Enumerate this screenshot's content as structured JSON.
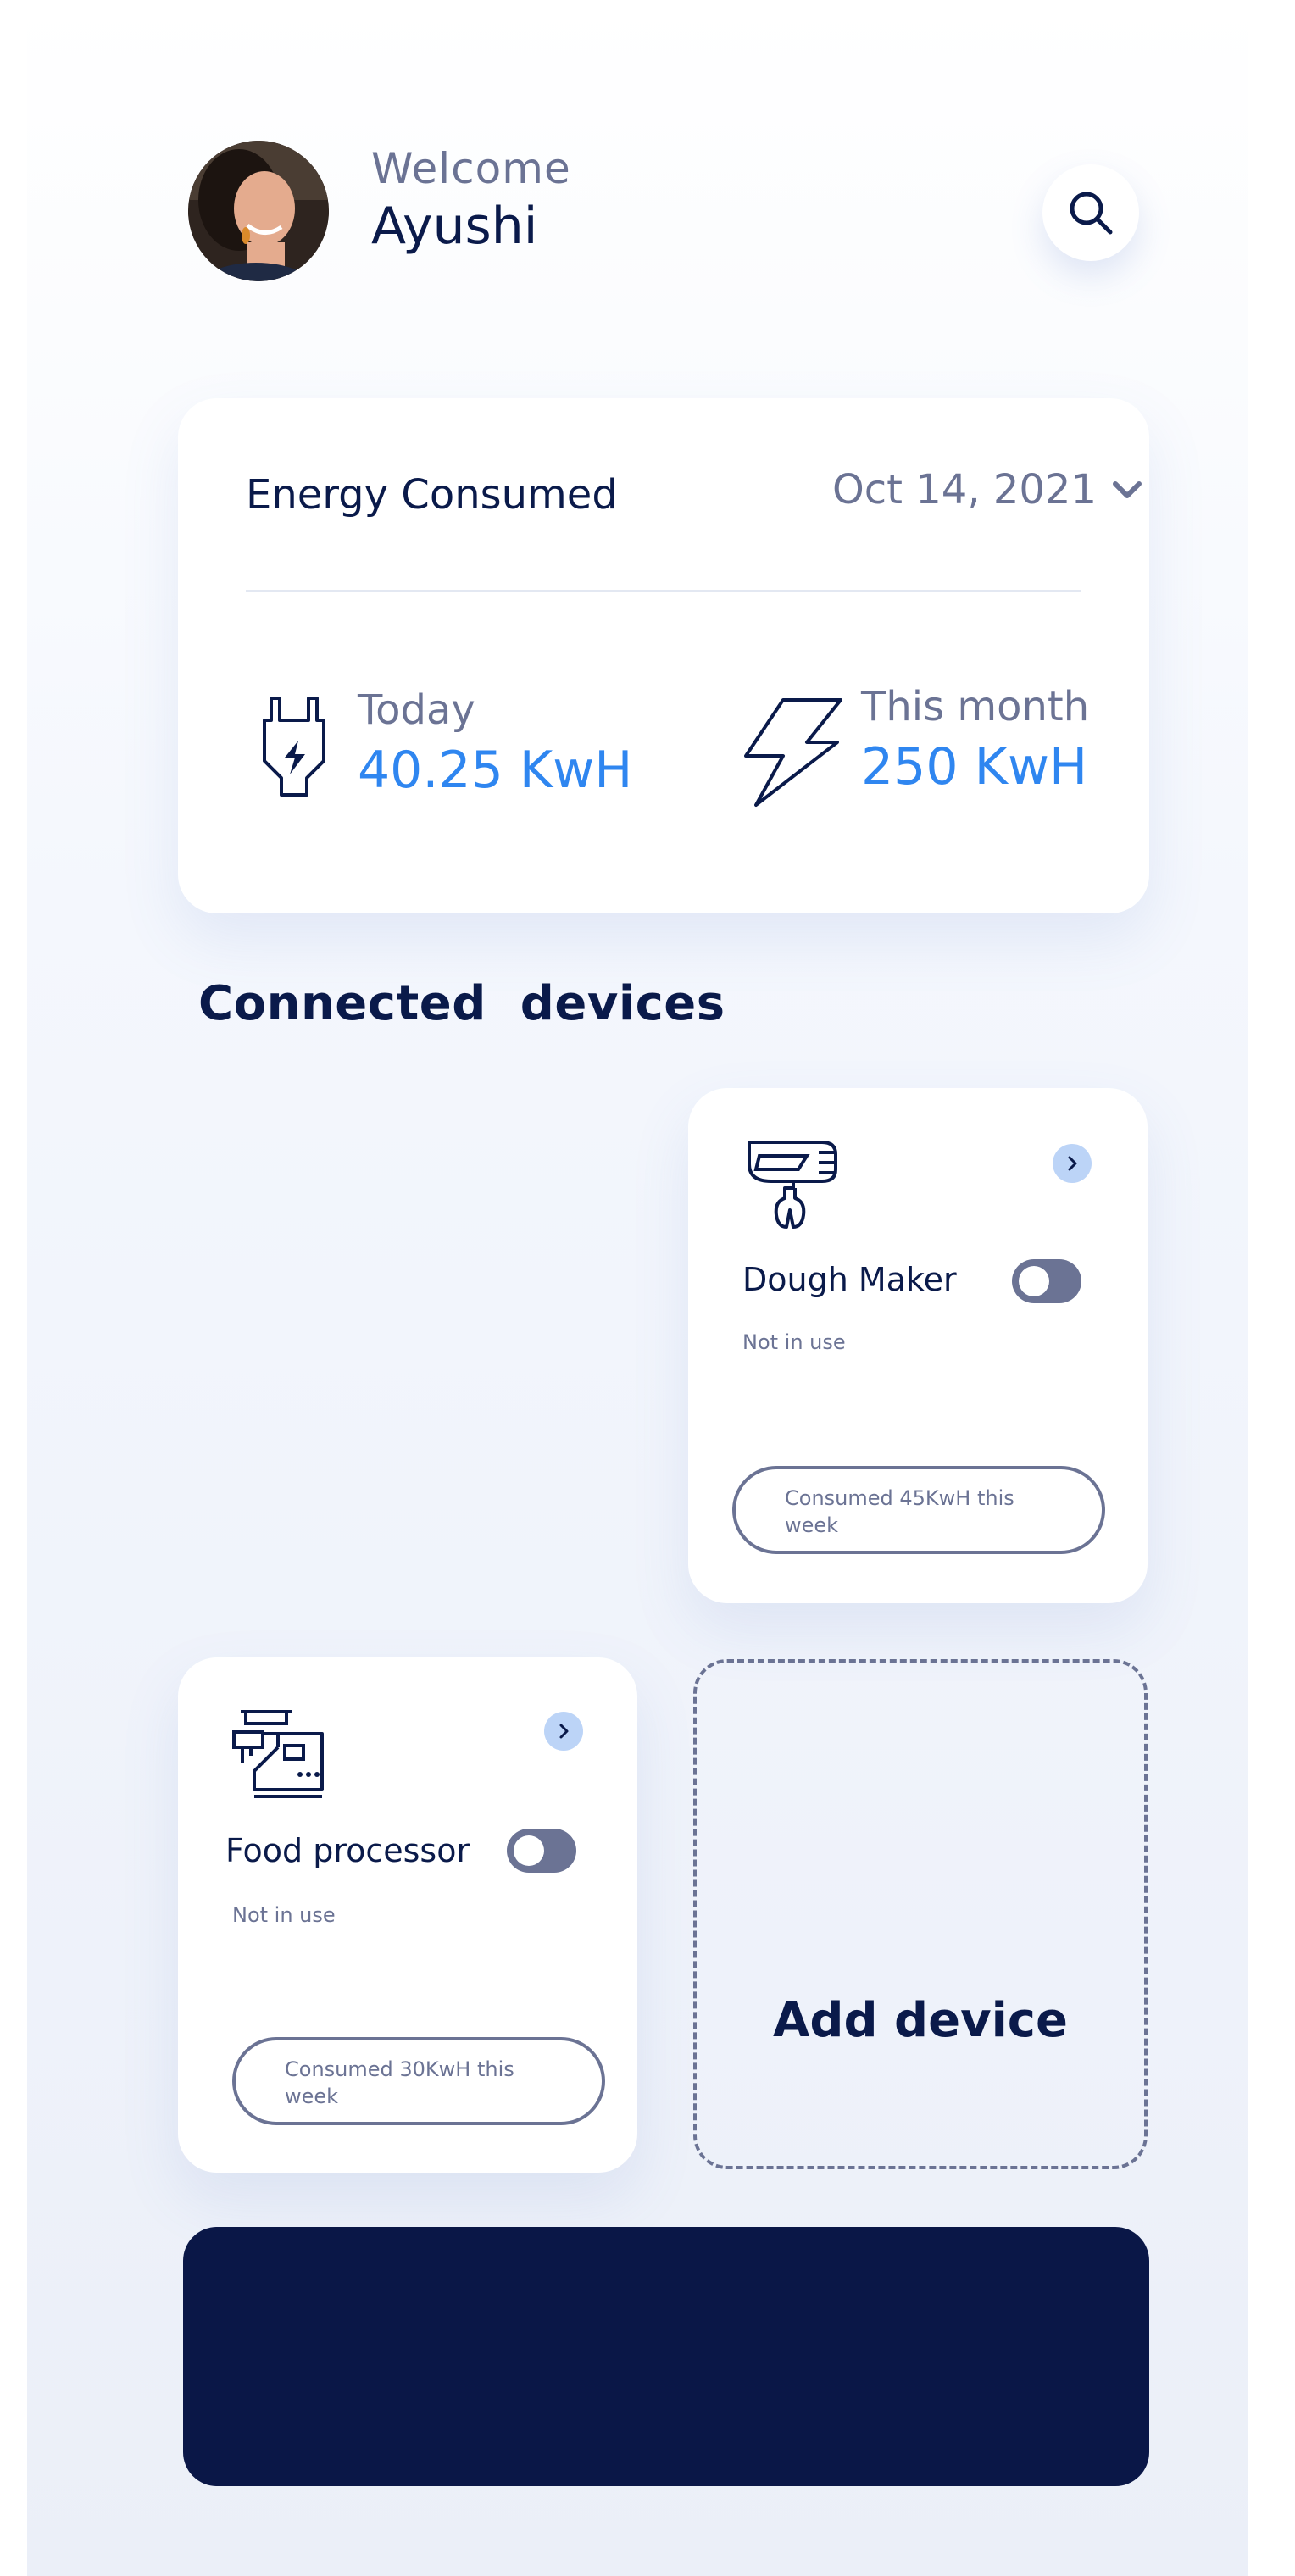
{
  "header": {
    "welcome": "Welcome",
    "user_name": "Ayushi",
    "avatar_icon": "user-avatar",
    "search_icon": "search-icon"
  },
  "energy": {
    "title": "Energy Consumed",
    "date": "Oct 14, 2021",
    "today": {
      "label": "Today",
      "value": "40.25 KwH",
      "icon": "plug-icon"
    },
    "month": {
      "label": "This month",
      "value": "250 KwH",
      "icon": "lightning-icon"
    }
  },
  "devices_section": {
    "title": "Connected  devices",
    "devices": [
      {
        "name": "Dough Maker",
        "status": "Not in use",
        "consumed": "Consumed 45KwH this week",
        "toggle_on": false,
        "icon": "hand-mixer-icon"
      },
      {
        "name": "Food processor",
        "status": "Not in use",
        "consumed": "Consumed 30KwH this week",
        "toggle_on": false,
        "icon": "meat-grinder-icon"
      }
    ],
    "add_label": "Add device"
  },
  "colors": {
    "primary": "#0a1a4a",
    "accent": "#2f86f0",
    "muted": "#6b7394",
    "panel": "#0a1747"
  }
}
